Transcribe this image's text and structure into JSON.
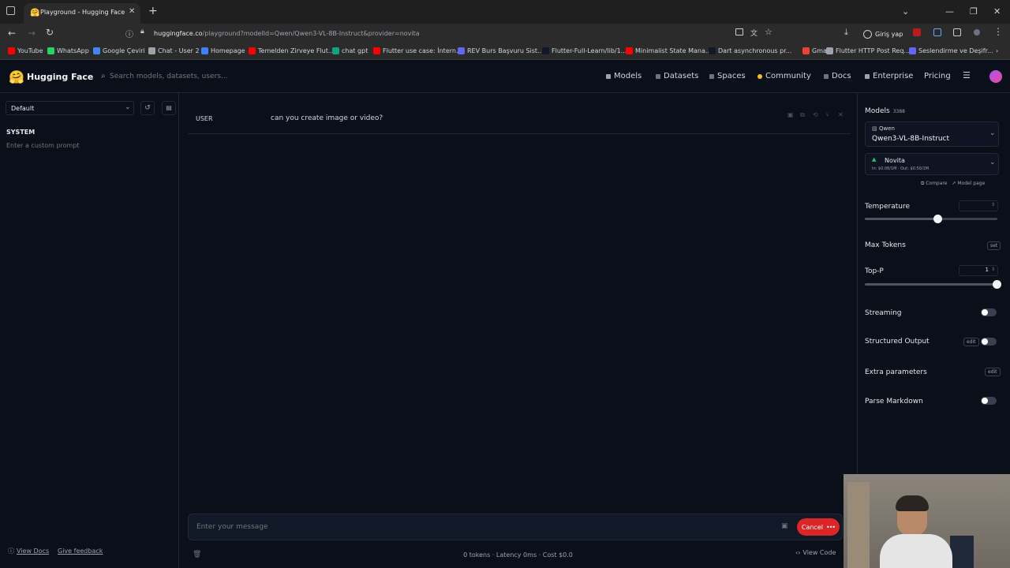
{
  "browser": {
    "tab_title": "Playground - Hugging Face",
    "url_domain": "huggingface.co",
    "url_path": "/playground?modelId=Qwen/Qwen3-VL-8B-Instruct&provider=novita",
    "signin_label": "Giriş yap",
    "bookmarks": [
      {
        "label": "YouTube",
        "color": "#ff0000"
      },
      {
        "label": "WhatsApp",
        "color": "#25d366"
      },
      {
        "label": "Google Çeviri",
        "color": "#4285f4"
      },
      {
        "label": "Chat - User 2",
        "color": "#9ca3af"
      },
      {
        "label": "Homepage",
        "color": "#3b82f6"
      },
      {
        "label": "Temelden Zirveye Flut...",
        "color": "#ff0000"
      },
      {
        "label": "chat gpt",
        "color": "#10a37f"
      },
      {
        "label": "Flutter use case: İntern...",
        "color": "#ff0000"
      },
      {
        "label": "REV Burs Başvuru Sist...",
        "color": "#6366f1"
      },
      {
        "label": "Flutter-Full-Learn/lib/1...",
        "color": "#111827"
      },
      {
        "label": "Minimalist State Mana...",
        "color": "#ff0000"
      },
      {
        "label": "Dart asynchronous pr...",
        "color": "#111827"
      },
      {
        "label": "Gmail",
        "color": "#ea4335"
      },
      {
        "label": "Flutter HTTP Post Req...",
        "color": "#9ca3af"
      },
      {
        "label": "Seslendirme ve Deşifr...",
        "color": "#6366f1"
      }
    ]
  },
  "hf": {
    "brand": "Hugging Face",
    "search_placeholder": "Search models, datasets, users...",
    "nav": [
      "Models",
      "Datasets",
      "Spaces",
      "Community",
      "Docs",
      "Enterprise",
      "Pricing"
    ]
  },
  "left": {
    "preset": "Default",
    "system_label": "SYSTEM",
    "system_placeholder": "Enter a custom prompt",
    "view_docs": "View Docs",
    "give_feedback": "Give feedback"
  },
  "chat": {
    "role": "USER",
    "message": "can you create image or video?",
    "input_placeholder": "Enter your message",
    "cancel_label": "Cancel",
    "stats": "0 tokens · Latency 0ms · Cost $0.0",
    "view_code": "View Code"
  },
  "right": {
    "models_label": "Models",
    "models_count": "3388",
    "model_org": "Qwen",
    "model_name": "Qwen3-VL-8B-Instruct",
    "provider": "Novita",
    "provider_price": "In: $0.08/1M · Out: $0.50/1M",
    "compare": "Compare",
    "model_page": "Model page",
    "temperature_label": "Temperature",
    "temperature_fraction": 0.55,
    "max_tokens_label": "Max Tokens",
    "max_tokens_btn": "set",
    "top_p_label": "Top-P",
    "top_p_value": "1",
    "streaming_label": "Streaming",
    "structured_label": "Structured Output",
    "structured_btn": "edit",
    "extra_label": "Extra parameters",
    "extra_btn": "edit",
    "parse_md_label": "Parse Markdown"
  },
  "colors": {
    "accent": "#dc2626",
    "brand_yellow": "#fbbf24"
  }
}
